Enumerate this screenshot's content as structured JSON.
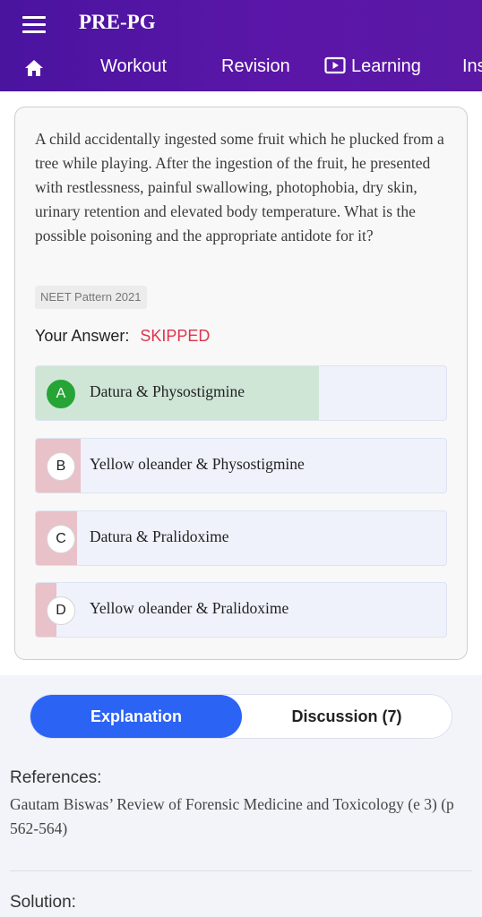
{
  "app": {
    "title": "PRE-PG"
  },
  "nav": {
    "items": [
      "Workout",
      "Revision",
      "Learning",
      "Ins"
    ]
  },
  "question": {
    "text": "A child accidentally ingested some fruit which he plucked from a tree while playing. After the ingestion of the fruit, he presented with restlessness, painful swallowing, photophobia, dry skin, urinary retention and elevated body temperature. What is the possible poisoning and the appropriate antidote for it?",
    "tag": "NEET Pattern 2021",
    "your_answer_label": "Your Answer:",
    "your_answer_value": "SKIPPED"
  },
  "options": [
    {
      "letter": "A",
      "text": "Datura & Physostigmine",
      "correct": true,
      "percent": 0.69,
      "fill_color": "#cfe6d7"
    },
    {
      "letter": "B",
      "text": "Yellow oleander & Physostigmine",
      "correct": false,
      "percent": 0.11,
      "fill_color": "#e8c1c9"
    },
    {
      "letter": "C",
      "text": "Datura & Pralidoxime",
      "correct": false,
      "percent": 0.1,
      "fill_color": "#e8c1c9"
    },
    {
      "letter": "D",
      "text": "Yellow oleander & Pralidoxime",
      "correct": false,
      "percent": 0.05,
      "fill_color": "#e8c1c9"
    }
  ],
  "tabs": {
    "explanation": "Explanation",
    "discussion": "Discussion (7)"
  },
  "references": {
    "title": "References:",
    "text": "Gautam Biswas’ Review of Forensic Medicine and Toxicology (e 3) (p 562-564)"
  },
  "solution": {
    "title": "Solution:"
  },
  "colors": {
    "header": "#5516a6",
    "accent": "#2b63f5",
    "skipped": "#e0344a",
    "correct": "#27a436"
  }
}
